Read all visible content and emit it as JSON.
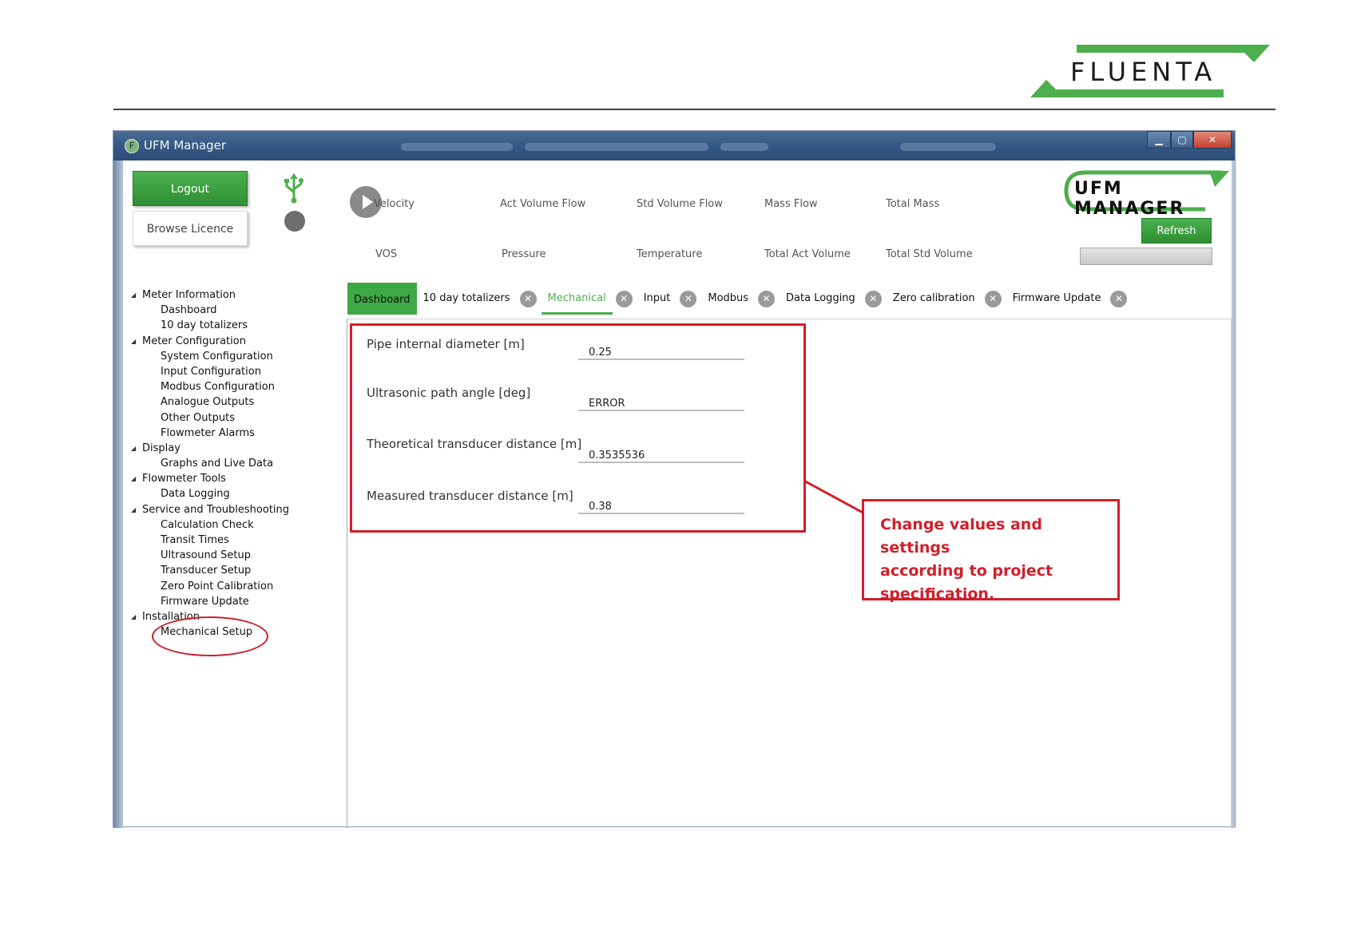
{
  "brand": {
    "logo_text": "FLUENTA",
    "brand_color": "#4cae4c"
  },
  "window": {
    "title": "UFM Manager",
    "app_icon_letter": "F",
    "controls": {
      "minimize": "▁",
      "maximize": "▢",
      "close": "✕"
    }
  },
  "toolbar": {
    "logout_label": "Logout",
    "browse_licence_label": "Browse Licence",
    "usb_icon": "⚲",
    "refresh_label": "Refresh",
    "ufm_logo_text": "UFM MANAGER",
    "progress": 0
  },
  "measurements": [
    "Velocity",
    "Act Volume Flow",
    "Std Volume Flow",
    "Mass Flow",
    "Total Mass",
    "VOS",
    "Pressure",
    "Temperature",
    "Total Act Volume",
    "Total Std Volume"
  ],
  "tree": [
    {
      "label": "Meter Information",
      "level": 0
    },
    {
      "label": "Dashboard",
      "level": 1
    },
    {
      "label": "10 day totalizers",
      "level": 1
    },
    {
      "label": "Meter Configuration",
      "level": 0
    },
    {
      "label": "System Configuration",
      "level": 1
    },
    {
      "label": "Input Configuration",
      "level": 1
    },
    {
      "label": "Modbus Configuration",
      "level": 1
    },
    {
      "label": "Analogue Outputs",
      "level": 1
    },
    {
      "label": "Other Outputs",
      "level": 1
    },
    {
      "label": "Flowmeter Alarms",
      "level": 1
    },
    {
      "label": "Display",
      "level": 0
    },
    {
      "label": "Graphs and Live Data",
      "level": 1
    },
    {
      "label": "Flowmeter Tools",
      "level": 0
    },
    {
      "label": "Data Logging",
      "level": 1
    },
    {
      "label": "Service and Troubleshooting",
      "level": 0
    },
    {
      "label": "Calculation Check",
      "level": 1
    },
    {
      "label": "Transit Times",
      "level": 1
    },
    {
      "label": "Ultrasound Setup",
      "level": 1
    },
    {
      "label": "Transducer Setup",
      "level": 1
    },
    {
      "label": "Zero Point Calibration",
      "level": 1
    },
    {
      "label": "Firmware Update",
      "level": 1
    },
    {
      "label": "Installation",
      "level": 0
    },
    {
      "label": "Mechanical Setup",
      "level": 1
    }
  ],
  "tabs": [
    {
      "label": "Dashboard",
      "closable": false,
      "state": "dashboard"
    },
    {
      "label": "10 day totalizers",
      "closable": true
    },
    {
      "label": "Mechanical",
      "closable": true,
      "state": "active"
    },
    {
      "label": "Input",
      "closable": true
    },
    {
      "label": "Modbus",
      "closable": true
    },
    {
      "label": "Data Logging",
      "closable": true
    },
    {
      "label": "Zero calibration",
      "closable": true
    },
    {
      "label": "Firmware Update",
      "closable": true
    }
  ],
  "tab_close_glyph": "✕",
  "form": {
    "fields": [
      {
        "label": "Pipe internal diameter [m]",
        "value": "0.25"
      },
      {
        "label": "Ultrasonic path angle [deg]",
        "value": "ERROR"
      },
      {
        "label": "Theoretical transducer distance [m]",
        "value": "0.3535536"
      },
      {
        "label": "Measured transducer distance [m]",
        "value": "0.38"
      }
    ]
  },
  "callout": {
    "lines": [
      "Change values and settings",
      "according to project",
      "specification."
    ],
    "color": "#d21f2a"
  }
}
